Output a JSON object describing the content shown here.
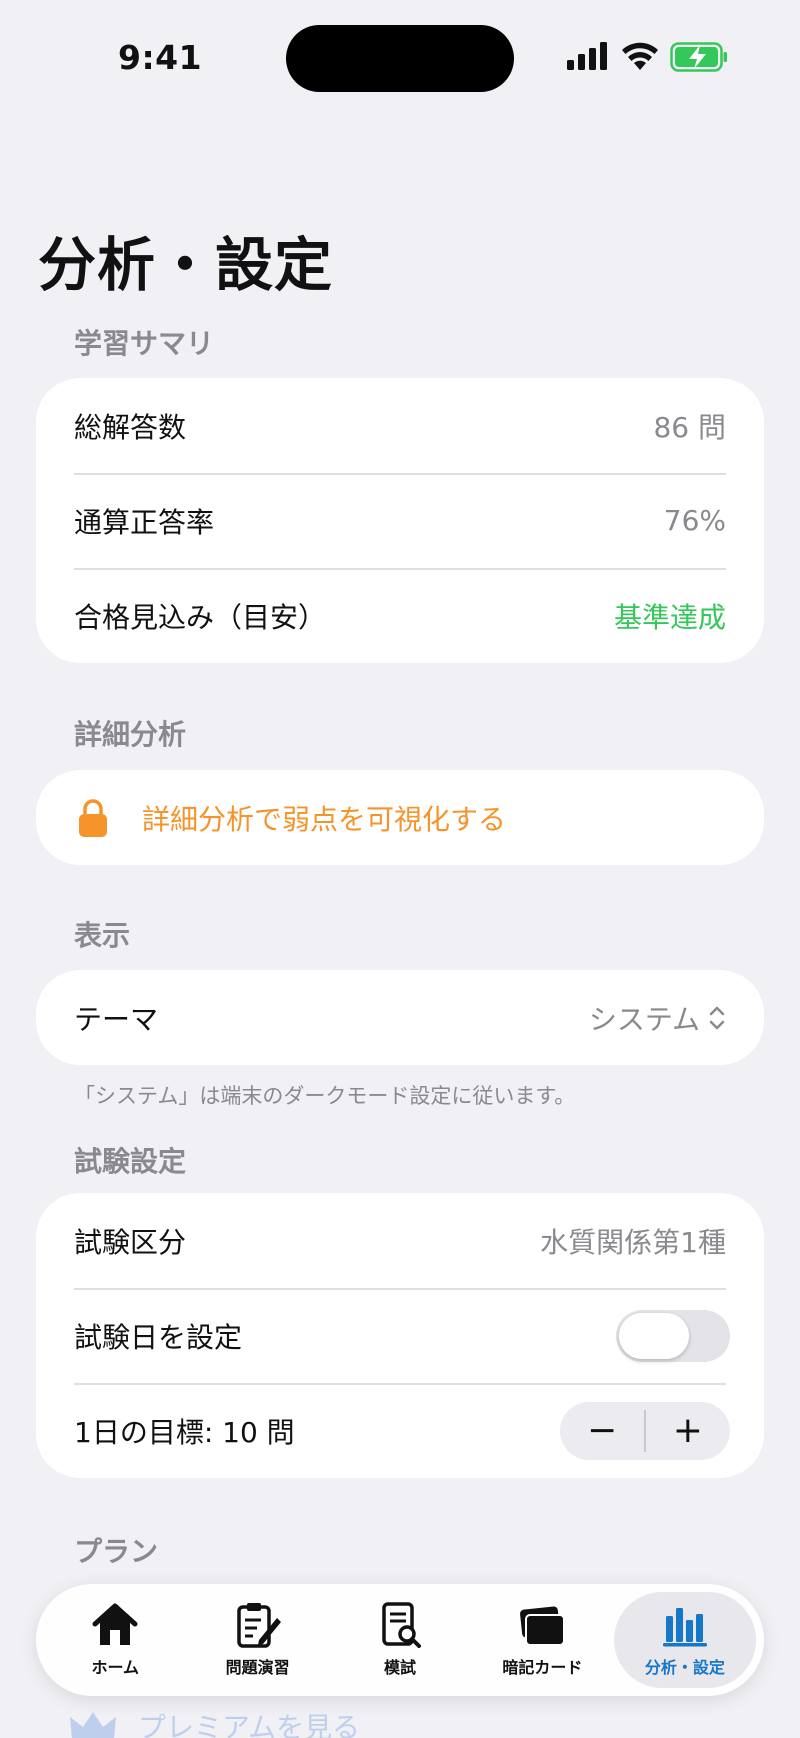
{
  "status_bar": {
    "time": "9:41"
  },
  "page_title": "分析・設定",
  "summary": {
    "header": "学習サマリ",
    "rows": [
      {
        "label": "総解答数",
        "value": "86 問"
      },
      {
        "label": "通算正答率",
        "value": "76%"
      },
      {
        "label": "合格見込み（目安）",
        "value": "基準達成",
        "value_color": "#34c759"
      }
    ]
  },
  "analysis": {
    "header": "詳細分析",
    "locked_label": "詳細分析で弱点を可視化する",
    "accent_color": "#f5942b"
  },
  "display": {
    "header": "表示",
    "theme_label": "テーマ",
    "theme_value": "システム",
    "footnote": "「システム」は端末のダークモード設定に従います。"
  },
  "exam": {
    "header": "試験設定",
    "category_label": "試験区分",
    "category_value": "水質関係第1種",
    "date_label": "試験日を設定",
    "date_toggle_on": false,
    "goal_label": "1日の目標: 10 問",
    "minus": "−",
    "plus": "+"
  },
  "plan": {
    "header": "プラン",
    "premium_link": "プレミアムを見る"
  },
  "tabs": [
    {
      "label": "ホーム",
      "icon": "house-icon"
    },
    {
      "label": "問題演習",
      "icon": "clipboard-pencil-icon"
    },
    {
      "label": "模試",
      "icon": "document-search-icon"
    },
    {
      "label": "暗記カード",
      "icon": "cards-icon"
    },
    {
      "label": "分析・設定",
      "icon": "chart-bars-icon",
      "active": true
    }
  ],
  "colors": {
    "active_tab": "#1677c9",
    "background": "#f0f0f5"
  }
}
